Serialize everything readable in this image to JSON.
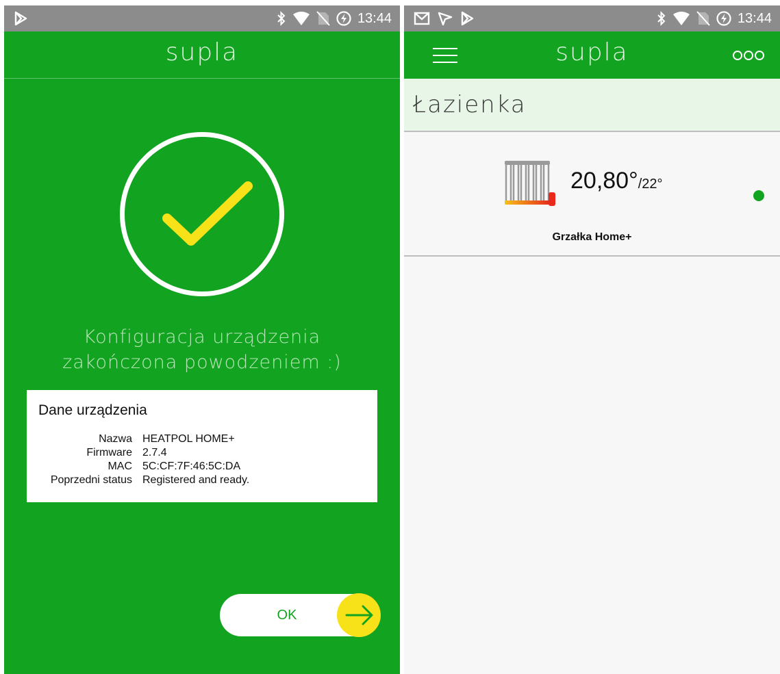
{
  "colors": {
    "brand_green": "#12a321",
    "status_bar_gray": "#8c8c8c",
    "check_yellow": "#f7e21a",
    "location_bg": "#e8f6e8",
    "online_dot": "#12a321"
  },
  "left_screen": {
    "status_bar": {
      "time": "13:44",
      "icons": [
        "play-store-icon",
        "bluetooth-icon",
        "wifi-icon",
        "no-sim-icon",
        "data-saver-icon"
      ]
    },
    "app_bar": {
      "title": "supla"
    },
    "success_icon": "checkmark-circle-icon",
    "success_message": {
      "line1": "Konfiguracja urządzenia",
      "line2": "zakończona powodzeniem :)"
    },
    "device_details": {
      "title": "Dane urządzenia",
      "rows": [
        {
          "key": "Nazwa",
          "value": "HEATPOL HOME+"
        },
        {
          "key": "Firmware",
          "value": "2.7.4"
        },
        {
          "key": "MAC",
          "value": "5C:CF:7F:46:5C:DA"
        },
        {
          "key": "Poprzedni status",
          "value": "Registered and ready."
        }
      ]
    },
    "ok_button": {
      "label": "OK",
      "icon": "arrow-right-icon"
    }
  },
  "right_screen": {
    "status_bar": {
      "time": "13:44",
      "icons": [
        "gmail-icon",
        "navigation-icon",
        "play-store-icon",
        "bluetooth-icon",
        "wifi-icon",
        "no-sim-icon",
        "data-saver-icon"
      ]
    },
    "app_bar": {
      "title": "supla",
      "menu_icon": "hamburger-menu-icon",
      "more_icon": "three-circles-icon"
    },
    "location": {
      "name": "Łazienka"
    },
    "channel": {
      "icon": "radiator-icon",
      "temperature": "20,80°",
      "target": "/22°",
      "caption": "Grzałka Home+",
      "online": true
    }
  }
}
